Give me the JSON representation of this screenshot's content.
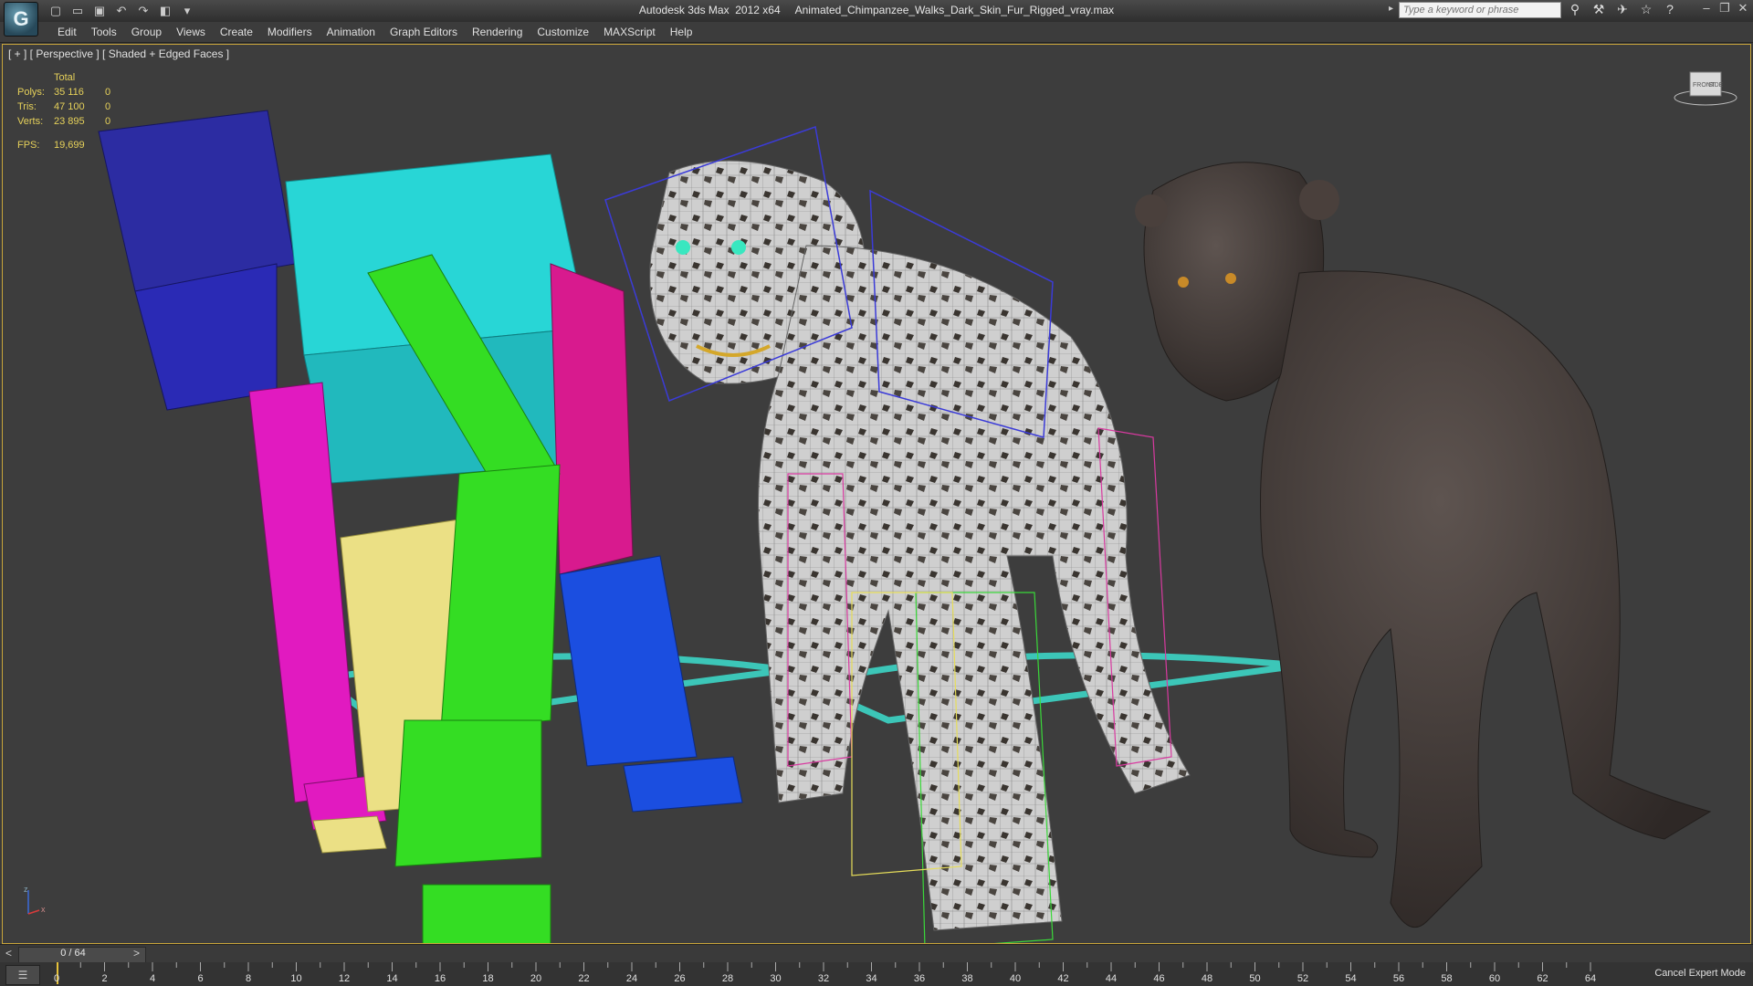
{
  "titlebar": {
    "app_logo_letter": "G",
    "title": "Autodesk 3ds Max  2012 x64     Animated_Chimpanzee_Walks_Dark_Skin_Fur_Rigged_vray.max",
    "search_placeholder": "Type a keyword or phrase",
    "quick_access_icons": [
      "new-file-icon",
      "open-file-icon",
      "save-icon",
      "undo-icon",
      "redo-icon",
      "project-folder-icon",
      "dropdown-icon"
    ],
    "tools_icons": [
      "binoculars-icon",
      "wrench-icon",
      "satellite-icon",
      "star-icon",
      "help-icon"
    ],
    "window_controls": [
      "minimize-icon",
      "restore-icon",
      "close-icon"
    ]
  },
  "menubar": {
    "items": [
      "Edit",
      "Tools",
      "Group",
      "Views",
      "Create",
      "Modifiers",
      "Animation",
      "Graph Editors",
      "Rendering",
      "Customize",
      "MAXScript",
      "Help"
    ]
  },
  "viewport": {
    "label": "[ + ] [ Perspective ] [ Shaded + Edged Faces ]",
    "stats": {
      "header": "Total",
      "rows": [
        {
          "label": "Polys:",
          "total": "35 116",
          "selected": "0"
        },
        {
          "label": "Tris:",
          "total": "47 100",
          "selected": "0"
        },
        {
          "label": "Verts:",
          "total": "23 895",
          "selected": "0"
        }
      ],
      "fps_label": "FPS:",
      "fps_value": "19,699"
    },
    "viewcube_labels": [
      "FRONT",
      "SIDE"
    ],
    "axis_labels": [
      "z",
      "x"
    ]
  },
  "timeslider": {
    "frame_display": "0 / 64",
    "prev_label": "<",
    "next_label": ">"
  },
  "trackbar": {
    "ruler_labels": [
      "0",
      "2",
      "4",
      "6",
      "8",
      "10",
      "12",
      "14",
      "16",
      "18",
      "20",
      "22",
      "24",
      "26",
      "28",
      "30",
      "32",
      "34",
      "36",
      "38",
      "40",
      "42",
      "44",
      "46",
      "48",
      "50",
      "52",
      "54",
      "56",
      "58",
      "60",
      "62",
      "64"
    ],
    "expert_mode_label": "Cancel Expert Mode"
  },
  "colors": {
    "viewport_bg": "#3d3d3d",
    "active_border": "#c8a53a",
    "stats_text": "#e6d15a",
    "rig_blue": "#2a2aa8",
    "rig_cyan": "#22d4d4",
    "rig_green": "#33dd22",
    "rig_magenta": "#dd1a9a",
    "rig_yellow": "#e6dd7a",
    "fur_skin": "#4a423f"
  }
}
